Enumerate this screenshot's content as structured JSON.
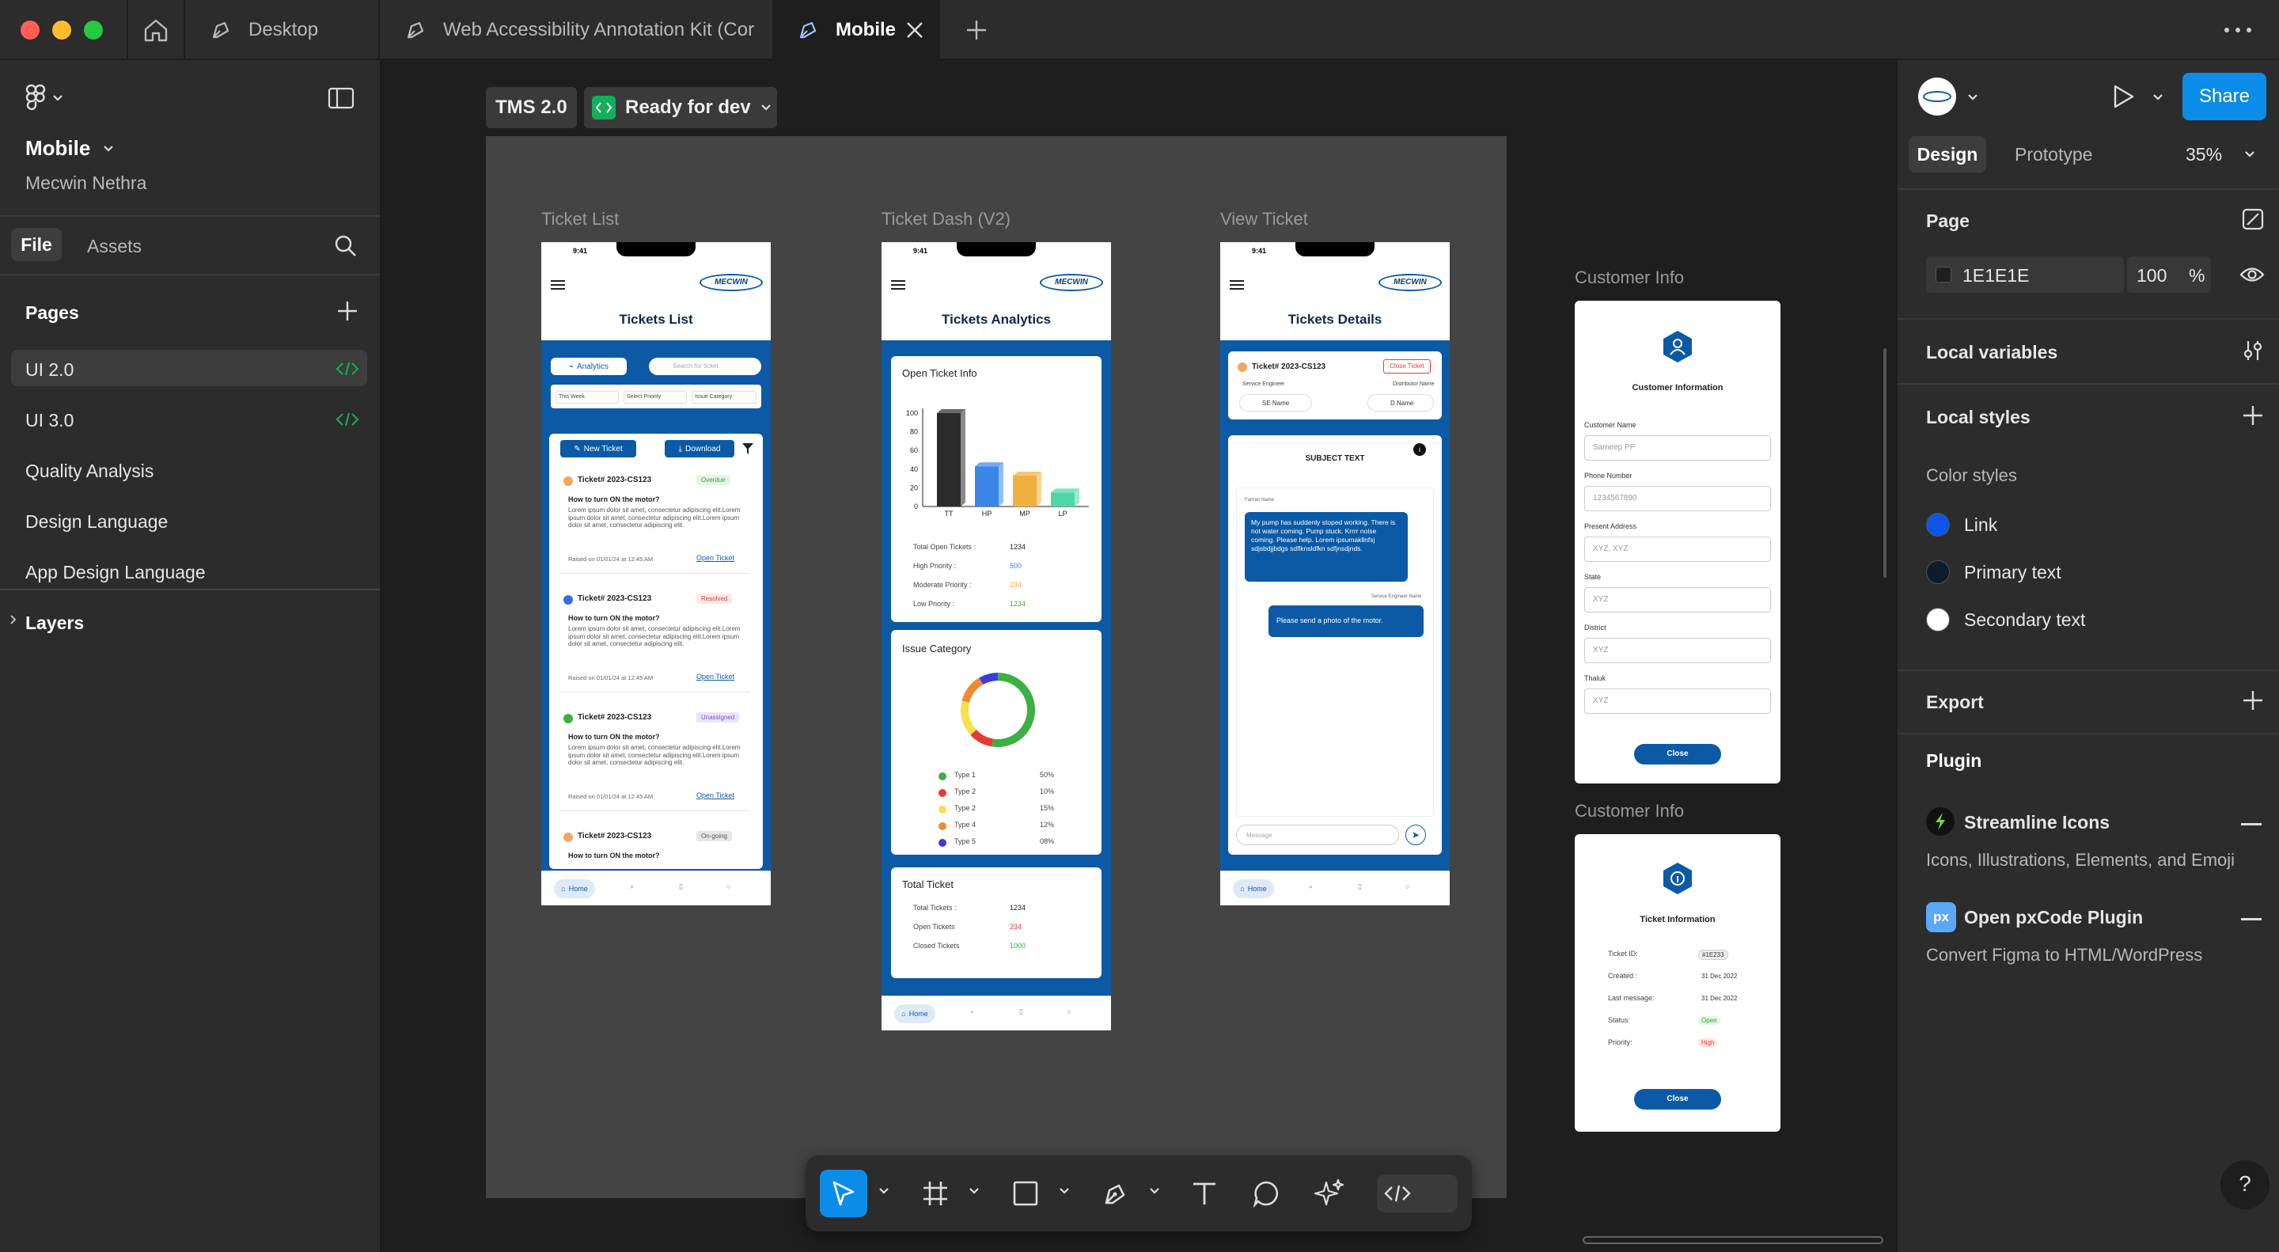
{
  "tabs": {
    "desktop": "Desktop",
    "kit": "Web Accessibility Annotation Kit (Cor",
    "mobile": "Mobile"
  },
  "file": {
    "name": "Mobile",
    "owner": "Mecwin Nethra",
    "tab_file": "File",
    "tab_assets": "Assets"
  },
  "pages": {
    "title": "Pages",
    "items": [
      "UI 2.0",
      "UI 3.0",
      "Quality Analysis",
      "Design Language",
      "App Design Language"
    ],
    "layers": "Layers"
  },
  "canvas": {
    "section_name": "TMS 2.0",
    "status": "Ready for dev",
    "frames": {
      "ticket_list": "Ticket List",
      "ticket_dash": "Ticket Dash (V2)",
      "view_ticket": "View Ticket",
      "customer_info_1": "Customer Info",
      "customer_info_2": "Customer Info"
    }
  },
  "ticket_list": {
    "time": "9:41",
    "logo": "MECWIN",
    "title": "Tickets List",
    "analytics": "Analytics",
    "search": "Search for ticket",
    "filters": [
      "This Week",
      "Select Priority",
      "Issue Category"
    ],
    "new_ticket": "New Ticket",
    "download": "Download",
    "tickets": [
      {
        "id": "Ticket# 2023-CS123",
        "status": "Overdue",
        "q": "How to turn ON the motor?",
        "body": "Lorem ipsum dolor sit amet, consectetur adipiscing elit.Lorem ipsum dolor sit amet, consectetur adipiscing elit.Lorem ipsum dolor sit amet, consectetur adipiscing elit.",
        "raised": "Raised on 01/01/24 at 12:45 AM",
        "open": "Open Ticket",
        "dot": "#f0a860",
        "badge_bg": "#e3f6e3",
        "badge_fg": "#3a9a3a"
      },
      {
        "id": "Ticket# 2023-CS123",
        "status": "Resolved",
        "q": "How to turn ON the motor?",
        "body": "Lorem ipsum dolor sit amet, consectetur adipiscing elit.Lorem ipsum dolor sit amet, consectetur adipiscing elit.Lorem ipsum dolor sit amet, consectetur adipiscing elit.",
        "raised": "Raised on 01/01/24 at 12:45 AM",
        "open": "Open Ticket",
        "dot": "#3b6be0",
        "badge_bg": "#fde8e8",
        "badge_fg": "#d04040"
      },
      {
        "id": "Ticket# 2023-CS123",
        "status": "Unassigned",
        "q": "How to turn ON the motor?",
        "body": "Lorem ipsum dolor sit amet, consectetur adipiscing elit.Lorem ipsum dolor sit amet, consectetur adipiscing elit.Lorem ipsum dolor sit amet, consectetur adipiscing elit.",
        "raised": "Raised on 01/01/24 at 12:45 AM",
        "open": "Open Ticket",
        "dot": "#3cb043",
        "badge_bg": "#ece4fb",
        "badge_fg": "#7a52c8"
      },
      {
        "id": "Ticket# 2023-CS123",
        "status": "On-going",
        "q": "How to turn ON the motor?",
        "body": "",
        "raised": "",
        "open": "",
        "dot": "#f0a860",
        "badge_bg": "#e6e6e6",
        "badge_fg": "#555"
      }
    ],
    "nav_home": "Home"
  },
  "ticket_dash": {
    "time": "9:41",
    "logo": "MECWIN",
    "title": "Tickets Analytics",
    "open_info_title": "Open Ticket Info",
    "chart": {
      "type": "bar",
      "categories": [
        "TT",
        "HP",
        "MP",
        "LP"
      ],
      "values": [
        100,
        43,
        33,
        15
      ],
      "ylim": [
        0,
        100
      ],
      "yticks": [
        "0",
        "20",
        "40",
        "60",
        "80",
        "100"
      ],
      "colors": [
        "#2b2b2b",
        "#3a86e8",
        "#f0b040",
        "#4fd6a8"
      ]
    },
    "stats": [
      {
        "label": "Total Open Tickets :",
        "value": "1234",
        "color": "#222"
      },
      {
        "label": "High Priority :",
        "value": "500",
        "color": "#3a86e8"
      },
      {
        "label": "Moderate Priority :",
        "value": "234",
        "color": "#f0b040"
      },
      {
        "label": "Low Priority :",
        "value": "1234",
        "color": "#3cb043"
      }
    ],
    "issue_title": "Issue Category",
    "donut": {
      "type": "pie",
      "labels": [
        "Type 1",
        "Type 2",
        "Type 2",
        "Type 4",
        "Type 5"
      ],
      "pct": [
        "50%",
        "10%",
        "15%",
        "12%",
        "08%"
      ],
      "values": [
        50,
        10,
        15,
        12,
        8
      ],
      "colors": [
        "#3cb043",
        "#e53935",
        "#f5e050",
        "#f08a30",
        "#3b3be0"
      ]
    },
    "total_title": "Total Ticket",
    "totals": [
      {
        "label": "Total Tickets :",
        "value": "1234",
        "color": "#222"
      },
      {
        "label": "Open Tickets",
        "value": "234",
        "color": "#e53935"
      },
      {
        "label": "Closed Tickets",
        "value": "1000",
        "color": "#3cb043"
      }
    ],
    "nav_home": "Home"
  },
  "view_ticket": {
    "time": "9:41",
    "logo": "MECWIN",
    "title": "Tickets Details",
    "ticket_id": "Ticket# 2023-CS123",
    "close_ticket": "Close Ticket",
    "service_engineer": "Service Engineer",
    "se_name": "SE Name",
    "distributor_name": "Distributor Name",
    "d_name": "D Name",
    "subject": "SUBJECT TEXT",
    "farmer_name": "Farmer Name",
    "msg1": "My pump has suddenly stoped working. There is not water coming. Pump stuck. Krrrr noise coming. Please help. Lorem ipsumakllnfsj sdjsbdjjbdgs sdflknsldfkn sdfjnsdjnds.",
    "se_label": "Service Engineer Name",
    "msg2": "Please send a photo of the motor.",
    "message_placeholder": "Message",
    "nav_home": "Home"
  },
  "customer_info": {
    "title": "Customer Information",
    "fields": [
      {
        "label": "Customer Name",
        "value": "Sameep PP"
      },
      {
        "label": "Phone Number",
        "value": "1234567890"
      },
      {
        "label": "Present Address",
        "value": "XYZ, XYZ"
      },
      {
        "label": "State",
        "value": "XYZ"
      },
      {
        "label": "District",
        "value": "XYZ"
      },
      {
        "label": "Thaluk",
        "value": "XYZ"
      }
    ],
    "close": "Close"
  },
  "ticket_info": {
    "title": "Ticket Information",
    "rows": [
      {
        "label": "Ticket ID:",
        "value": "#1E233"
      },
      {
        "label": "Created :",
        "value": "31 Dec 2022"
      },
      {
        "label": "Last message:",
        "value": "31 Dec 2022"
      },
      {
        "label": "Status:",
        "value": "Open"
      },
      {
        "label": "Priority:",
        "value": "High"
      }
    ],
    "close": "Close"
  },
  "right": {
    "share": "Share",
    "tab_design": "Design",
    "tab_prototype": "Prototype",
    "zoom": "35%",
    "page_title": "Page",
    "page_color": "1E1E1E",
    "page_opacity": "100",
    "pct": "%",
    "local_variables": "Local variables",
    "local_styles": "Local styles",
    "color_styles": "Color styles",
    "styles": [
      {
        "name": "Link",
        "color": "#0d56e8"
      },
      {
        "name": "Primary text",
        "color": "#0d1b2a"
      },
      {
        "name": "Secondary text",
        "color": "#ffffff"
      }
    ],
    "export": "Export",
    "plugin": "Plugin",
    "plugins": [
      {
        "name": "Streamline Icons",
        "desc": "Icons, Illustrations, Elements, and Emoji"
      },
      {
        "name": "Open pxCode Plugin",
        "desc": "Convert Figma to HTML/WordPress"
      }
    ],
    "help": "?"
  },
  "colors": {
    "accent": "#0c8ce9",
    "ready": "#14ae5c",
    "brand_blue": "#0c5aa5"
  }
}
